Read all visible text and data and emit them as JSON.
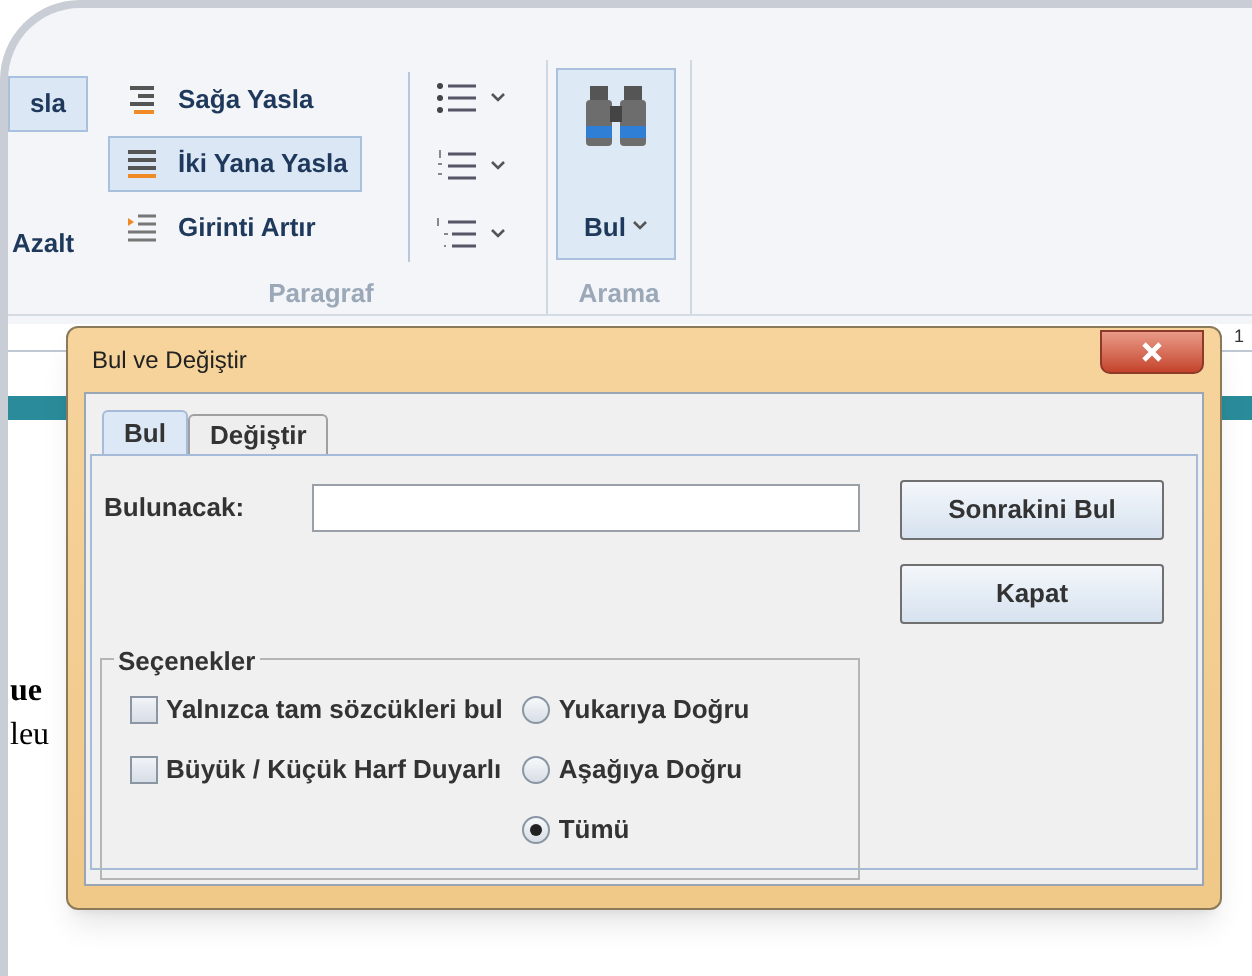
{
  "ribbon": {
    "partial_button": {
      "label": "sla",
      "selected": true
    },
    "partial_label": "Azalt",
    "paragraph_buttons": [
      {
        "label": "Sağa Yasla",
        "selected": false,
        "kind": "right"
      },
      {
        "label": "İki Yana Yasla",
        "selected": true,
        "kind": "justify"
      },
      {
        "label": "Girinti Artır",
        "selected": false,
        "kind": "indent"
      }
    ],
    "find_button": {
      "label": "Bul"
    },
    "groups": [
      {
        "label": "Paragraf"
      },
      {
        "label": "Arama"
      }
    ]
  },
  "ruler": {
    "label": "1"
  },
  "document": {
    "lines": [
      {
        "text": "ue",
        "bold": true
      },
      {
        "text": "leu",
        "bold": false
      }
    ]
  },
  "dialog": {
    "title": "Bul ve Değiştir",
    "tabs": [
      {
        "label": "Bul",
        "selected": true
      },
      {
        "label": "Değiştir",
        "selected": false
      }
    ],
    "find_label": "Bulunacak:",
    "buttons": [
      {
        "label": "Sonrakini Bul"
      },
      {
        "label": "Kapat"
      }
    ],
    "options": {
      "title": "Seçenekler",
      "checkboxes": [
        {
          "label": "Yalnızca tam sözcükleri bul",
          "checked": false
        },
        {
          "label": "Büyük / Küçük Harf Duyarlı",
          "checked": false
        }
      ],
      "radios": [
        {
          "label": "Yukarıya Doğru",
          "selected": false
        },
        {
          "label": "Aşağıya Doğru",
          "selected": false
        },
        {
          "label": "Tümü",
          "selected": true
        }
      ]
    }
  }
}
